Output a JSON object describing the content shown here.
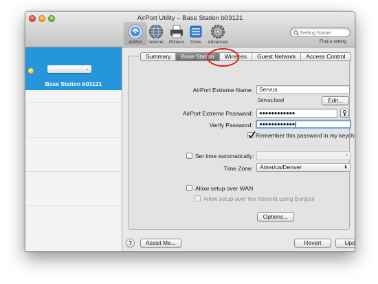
{
  "window": {
    "title": "AirPort Utility – Base Station b03121"
  },
  "toolbar": {
    "items": [
      {
        "label": "AirPort",
        "icon": "airport-icon"
      },
      {
        "label": "Internet",
        "icon": "globe-icon"
      },
      {
        "label": "Printers",
        "icon": "printer-icon"
      },
      {
        "label": "Disks",
        "icon": "disk-icon"
      },
      {
        "label": "Advanced",
        "icon": "gear-icon"
      }
    ],
    "search": {
      "placeholder": "Setting Name",
      "caption": "Find a setting"
    }
  },
  "sidebar": {
    "selected": {
      "name": "Base Station b03121",
      "status_color": "#f3c41b"
    }
  },
  "tabs": [
    "Summary",
    "Base Station",
    "Wireless",
    "Guest Network",
    "Access Control"
  ],
  "active_tab": "Base Station",
  "highlighted_tab": "Wireless",
  "form": {
    "name_label": "AirPort Extreme Name:",
    "name_value": "Servus",
    "local_name": "Servus.local",
    "edit_button": "Edit...",
    "password_label": "AirPort Extreme Password:",
    "password_value": "●●●●●●●●●●●●",
    "verify_label": "Verify Password:",
    "verify_value": "●●●●●●●●●●●●",
    "remember_label": "Remember this password in my keychain",
    "remember_checked": true,
    "set_time_label": "Set time automatically:",
    "set_time_checked": false,
    "time_zone_label": "Time Zone:",
    "time_zone_value": "America/Denver",
    "wan_label": "Allow setup over WAN",
    "wan_checked": false,
    "bonjour_label": "Allow setup over the Internet using Bonjour",
    "bonjour_checked": false,
    "options_button": "Options..."
  },
  "footer": {
    "help": "?",
    "assist_button": "Assist Me...",
    "revert_button": "Revert",
    "update_button": "Update"
  },
  "colors": {
    "selection_blue": "#2596da",
    "highlight_circle": "#e01b1b",
    "focus_ring": "#6aa4dd"
  }
}
